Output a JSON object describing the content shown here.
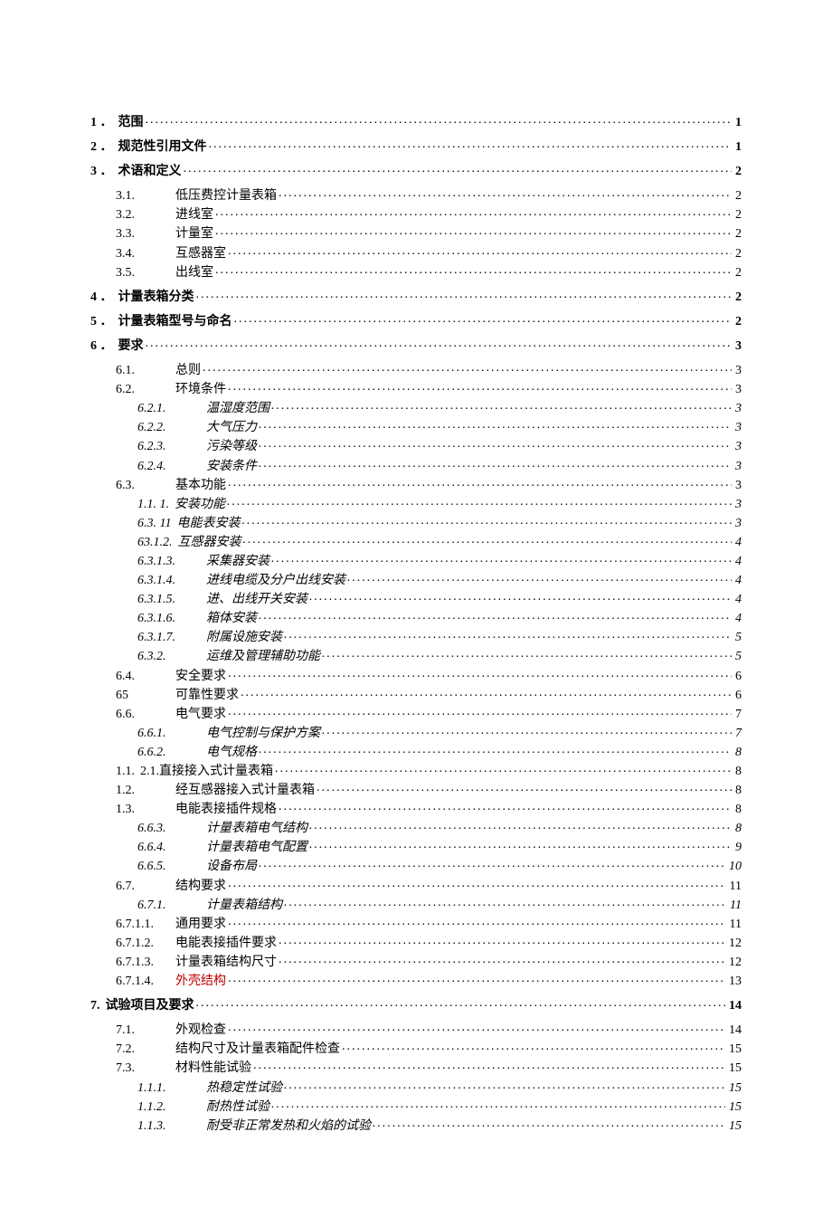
{
  "toc": [
    {
      "num": "1",
      "sep": "．",
      "title": "范围",
      "page": "1",
      "level": 0,
      "bold": true,
      "italic": false,
      "gap": false
    },
    {
      "num": "2",
      "sep": "．",
      "title": "规范性引用文件",
      "page": "1",
      "level": 0,
      "bold": true,
      "italic": false,
      "gap": true
    },
    {
      "num": "3",
      "sep": "．",
      "title": "术语和定义",
      "page": "2",
      "level": 0,
      "bold": true,
      "italic": false,
      "gap": true
    },
    {
      "num": "3.1.",
      "sep": "",
      "title": "低压费控计量表箱",
      "page": "2",
      "level": 1,
      "bold": false,
      "italic": false,
      "gap": true,
      "wide": true
    },
    {
      "num": "3.2.",
      "sep": "",
      "title": "进线室",
      "page": "2",
      "level": 1,
      "bold": false,
      "italic": false,
      "gap": false,
      "wide": true
    },
    {
      "num": "3.3.",
      "sep": "",
      "title": "计量室",
      "page": "2",
      "level": 1,
      "bold": false,
      "italic": false,
      "gap": false,
      "wide": true
    },
    {
      "num": "3.4.",
      "sep": "",
      "title": "互感器室",
      "page": "2",
      "level": 1,
      "bold": false,
      "italic": false,
      "gap": false,
      "wide": true
    },
    {
      "num": "3.5.",
      "sep": "",
      "title": "出线室",
      "page": "2",
      "level": 1,
      "bold": false,
      "italic": false,
      "gap": false,
      "wide": true
    },
    {
      "num": "4",
      "sep": "．",
      "title": "计量表箱分类",
      "page": "2",
      "level": 0,
      "bold": true,
      "italic": false,
      "gap": true
    },
    {
      "num": "5",
      "sep": "．",
      "title": "计量表箱型号与命名",
      "page": "2",
      "level": 0,
      "bold": true,
      "italic": false,
      "gap": true
    },
    {
      "num": "6",
      "sep": "．",
      "title": "要求",
      "page": "3",
      "level": 0,
      "bold": true,
      "italic": false,
      "gap": true
    },
    {
      "num": "6.1.",
      "sep": "",
      "title": "总则",
      "page": "3",
      "level": 1,
      "bold": false,
      "italic": false,
      "gap": true,
      "wide": true
    },
    {
      "num": "6.2.",
      "sep": "",
      "title": "环境条件",
      "page": "3",
      "level": 1,
      "bold": false,
      "italic": false,
      "gap": false,
      "wide": true
    },
    {
      "num": "6.2.1.",
      "sep": "",
      "title": "温湿度范围",
      "page": "3",
      "level": 2,
      "bold": false,
      "italic": true,
      "gap": false,
      "wider": true
    },
    {
      "num": "6.2.2.",
      "sep": "",
      "title": "大气压力",
      "page": "3",
      "level": 2,
      "bold": false,
      "italic": true,
      "gap": false,
      "wider": true
    },
    {
      "num": "6.2.3.",
      "sep": "",
      "title": "污染等级",
      "page": "3",
      "level": 2,
      "bold": false,
      "italic": true,
      "gap": false,
      "wider": true
    },
    {
      "num": "6.2.4.",
      "sep": "",
      "title": "安装条件",
      "page": "3",
      "level": 2,
      "bold": false,
      "italic": true,
      "gap": false,
      "wider": true
    },
    {
      "num": "6.3.",
      "sep": "",
      "title": "基本功能",
      "page": "3",
      "level": 1,
      "bold": false,
      "italic": false,
      "gap": false,
      "wide": true
    },
    {
      "num": "1.1.   1.",
      "sep": "",
      "title": "安装功能",
      "page": "3",
      "level": 2,
      "bold": false,
      "italic": true,
      "gap": false
    },
    {
      "num": "6.3.   11",
      "sep": "",
      "title": "电能表安装",
      "page": "3",
      "level": 2,
      "bold": false,
      "italic": true,
      "gap": false
    },
    {
      "num": "63.1.2.",
      "sep": "",
      "title": "互感器安装",
      "page": "4",
      "level": 2,
      "bold": false,
      "italic": true,
      "gap": false
    },
    {
      "num": "6.3.1.3.",
      "sep": "",
      "title": "采集器安装",
      "page": "4",
      "level": 2,
      "bold": false,
      "italic": true,
      "gap": false,
      "wider": true
    },
    {
      "num": "6.3.1.4.",
      "sep": "",
      "title": "进线电缆及分户出线安装",
      "page": "4",
      "level": 2,
      "bold": false,
      "italic": true,
      "gap": false,
      "wider": true
    },
    {
      "num": "6.3.1.5.",
      "sep": "",
      "title": "进、出线开关安装",
      "page": "4",
      "level": 2,
      "bold": false,
      "italic": true,
      "gap": false,
      "wider": true
    },
    {
      "num": "6.3.1.6.",
      "sep": "",
      "title": "箱体安装",
      "page": "4",
      "level": 2,
      "bold": false,
      "italic": true,
      "gap": false,
      "wider": true
    },
    {
      "num": "6.3.1.7.",
      "sep": "",
      "title": "附属设施安装",
      "page": "5",
      "level": 2,
      "bold": false,
      "italic": true,
      "gap": false,
      "wider": true
    },
    {
      "num": "6.3.2.",
      "sep": "",
      "title": "运维及管理辅助功能",
      "page": "5",
      "level": 2,
      "bold": false,
      "italic": true,
      "gap": false,
      "wider": true
    },
    {
      "num": "6.4.",
      "sep": "",
      "title": "安全要求",
      "page": "6",
      "level": 1,
      "bold": false,
      "italic": false,
      "gap": false,
      "wide": true
    },
    {
      "num": "65",
      "sep": "",
      "title": "可靠性要求",
      "page": "6",
      "level": 1,
      "bold": false,
      "italic": false,
      "gap": false,
      "wide": true
    },
    {
      "num": "6.6.",
      "sep": "",
      "title": "电气要求",
      "page": "7",
      "level": 1,
      "bold": false,
      "italic": false,
      "gap": false,
      "wide": true
    },
    {
      "num": "6.6.1.",
      "sep": "",
      "title": "电气控制与保护方案",
      "page": "7",
      "level": 2,
      "bold": false,
      "italic": true,
      "gap": false,
      "wider": true
    },
    {
      "num": "6.6.2.",
      "sep": "",
      "title": "电气规格",
      "page": "8",
      "level": 2,
      "bold": false,
      "italic": true,
      "gap": false,
      "wider": true
    },
    {
      "num": "1.1.",
      "sep": "",
      "title": "2.1.直接接入式计量表箱",
      "page": "8",
      "level": 3,
      "bold": false,
      "italic": false,
      "gap": false
    },
    {
      "num": "1.2.",
      "sep": "",
      "title": "经互感器接入式计量表箱",
      "page": "8",
      "level": 3,
      "bold": false,
      "italic": false,
      "gap": false,
      "wide": true
    },
    {
      "num": "1.3.",
      "sep": "",
      "title": "电能表接插件规格",
      "page": "8",
      "level": 3,
      "bold": false,
      "italic": false,
      "gap": false,
      "wide": true
    },
    {
      "num": "6.6.3.",
      "sep": "",
      "title": "计量表箱电气结构",
      "page": "8",
      "level": 2,
      "bold": false,
      "italic": true,
      "gap": false,
      "wider": true
    },
    {
      "num": "6.6.4.",
      "sep": "",
      "title": "计量表箱电气配置",
      "page": "9",
      "level": 2,
      "bold": false,
      "italic": true,
      "gap": false,
      "wider": true
    },
    {
      "num": "6.6.5.",
      "sep": "",
      "title": "设备布局",
      "page": "10",
      "level": 2,
      "bold": false,
      "italic": true,
      "gap": false,
      "wider": true
    },
    {
      "num": "6.7.",
      "sep": "",
      "title": "结构要求",
      "page": "11",
      "level": 1,
      "bold": false,
      "italic": false,
      "gap": false,
      "wide": true
    },
    {
      "num": "6.7.1.",
      "sep": "",
      "title": "计量表箱结构",
      "page": "11",
      "level": 2,
      "bold": false,
      "italic": true,
      "gap": false,
      "wider": true
    },
    {
      "num": "6.7.1.1.",
      "sep": "",
      "title": "通用要求",
      "page": "11",
      "level": 3,
      "bold": false,
      "italic": false,
      "gap": false,
      "wide": true
    },
    {
      "num": "6.7.1.2.",
      "sep": "",
      "title": "电能表接插件要求",
      "page": "12",
      "level": 3,
      "bold": false,
      "italic": false,
      "gap": false,
      "wide": true
    },
    {
      "num": "6.7.1.3.",
      "sep": "",
      "title": "计量表箱结构尺寸",
      "page": "12",
      "level": 3,
      "bold": false,
      "italic": false,
      "gap": false,
      "wide": true
    },
    {
      "num": "6.7.1.4.",
      "sep": "",
      "title": "外壳结构",
      "page": "13",
      "level": 3,
      "bold": false,
      "italic": false,
      "gap": false,
      "wide": true,
      "red": true
    },
    {
      "num": "7.",
      "sep": "",
      "title": "试验项目及要求",
      "page": "14",
      "level": 0,
      "bold": true,
      "italic": false,
      "gap": true,
      "nosepspace": true
    },
    {
      "num": "7.1.",
      "sep": "",
      "title": "外观检查",
      "page": "14",
      "level": 1,
      "bold": false,
      "italic": false,
      "gap": true,
      "wide": true
    },
    {
      "num": "7.2.",
      "sep": "",
      "title": "结构尺寸及计量表箱配件检查",
      "page": "15",
      "level": 1,
      "bold": false,
      "italic": false,
      "gap": false,
      "wide": true
    },
    {
      "num": "7.3.",
      "sep": "",
      "title": "材料性能试验",
      "page": "15",
      "level": 1,
      "bold": false,
      "italic": false,
      "gap": false,
      "wide": true
    },
    {
      "num": "1.1.1.",
      "sep": "",
      "title": "热稳定性试验",
      "page": "15",
      "level": 2,
      "bold": false,
      "italic": true,
      "gap": false,
      "wider": true
    },
    {
      "num": "1.1.2.",
      "sep": "",
      "title": "耐热性试验",
      "page": "15",
      "level": 2,
      "bold": false,
      "italic": true,
      "gap": false,
      "wider": true
    },
    {
      "num": "1.1.3.",
      "sep": "",
      "title": "耐受非正常发热和火焰的试验",
      "page": "15",
      "level": 2,
      "bold": false,
      "italic": true,
      "gap": false,
      "wider": true
    }
  ]
}
